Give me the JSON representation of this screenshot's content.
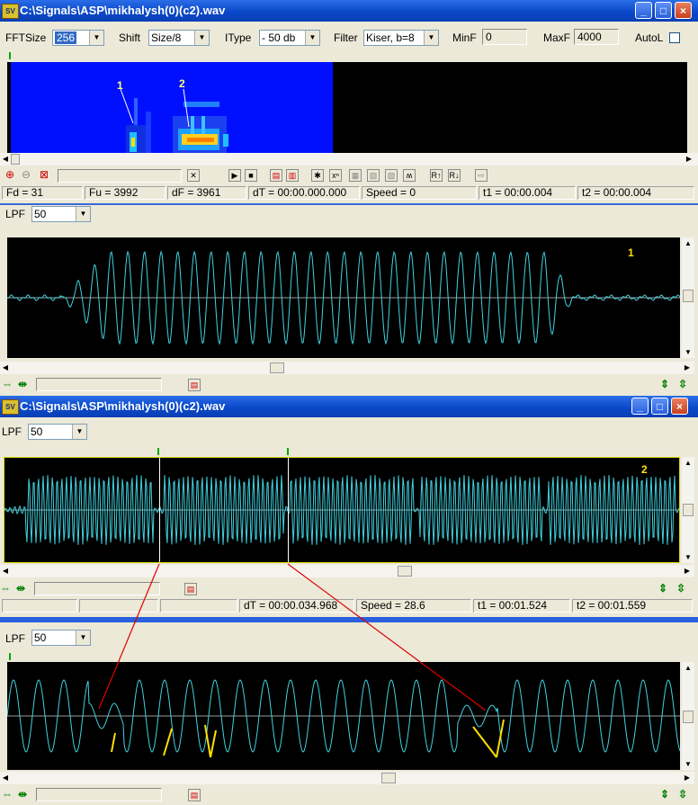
{
  "window1": {
    "title": "C:\\Signals\\ASP\\mikhalysh(0)(c2).wav",
    "toolbar": {
      "fftsize_label": "FFTSize",
      "fftsize_value": "256",
      "shift_label": "Shift",
      "shift_value": "Size/8",
      "itype_label": "IType",
      "itype_value": "- 50 db",
      "filter_label": "Filter",
      "filter_value": "Kiser, b=8",
      "minf_label": "MinF",
      "minf_value": "0",
      "maxf_label": "MaxF",
      "maxf_value": "4000",
      "autol_label": "AutoL"
    },
    "spectrogram_annotations": [
      "1",
      "2"
    ],
    "status": {
      "fd": "Fd = 31",
      "fu": "Fu = 3992",
      "df": "dF = 3961",
      "dt": "dT = 00:00.000.000",
      "speed": "Speed = 0",
      "t1": "t1 = 00:00.004",
      "t2": "t2 = 00:00.004"
    },
    "lpf_label": "LPF",
    "lpf_value": "50",
    "plot_annotation": "1"
  },
  "window2": {
    "title": "C:\\Signals\\ASP\\mikhalysh(0)(c2).wav",
    "lpf_label": "LPF",
    "lpf_value": "50",
    "plot_annotation": "2",
    "status": {
      "dt": "dT = 00:00.034.968",
      "speed": "Speed = 28.6",
      "t1": "t1 = 00:01.524",
      "t2": "t2 = 00:01.559"
    }
  },
  "window3": {
    "lpf_label": "LPF",
    "lpf_value": "50"
  },
  "colors": {
    "signal": "#3fd3e0",
    "annotation": "#ffe000",
    "pointer": "#e00000",
    "spectro_bg": "#0010ff",
    "plot_bg": "#000000",
    "titlebar": "#0a48c8"
  },
  "icons": [
    "zoom-in-icon",
    "zoom-out-icon",
    "zoom-reset-icon",
    "play-icon",
    "stop-icon",
    "fit-icon",
    "arrow-expand-icon"
  ]
}
